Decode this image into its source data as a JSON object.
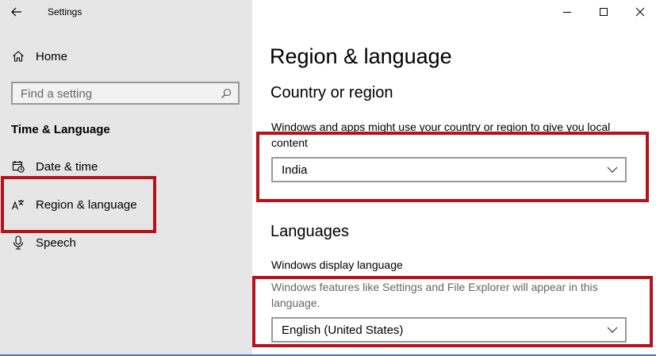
{
  "window": {
    "title": "Settings",
    "controls": [
      "minimize",
      "maximize",
      "close"
    ]
  },
  "sidebar": {
    "home_label": "Home",
    "search_placeholder": "Find a setting",
    "section_title": "Time & Language",
    "items": [
      {
        "label": "Date & time",
        "icon": "calendar-clock-icon"
      },
      {
        "label": "Region & language",
        "icon": "language-icon"
      },
      {
        "label": "Speech",
        "icon": "microphone-icon"
      }
    ]
  },
  "main": {
    "title": "Region & language",
    "country": {
      "heading": "Country or region",
      "description": "Windows and apps might use your country or region to give you local content",
      "selected": "India"
    },
    "languages": {
      "heading": "Languages",
      "display_label": "Windows display language",
      "display_description": "Windows features like Settings and File Explorer will appear in this language.",
      "selected": "English (United States)"
    }
  },
  "colors": {
    "sidebar_bg": "#e6e6e6",
    "highlight": "#b5121b",
    "accent_line": "#3a7bd5"
  }
}
